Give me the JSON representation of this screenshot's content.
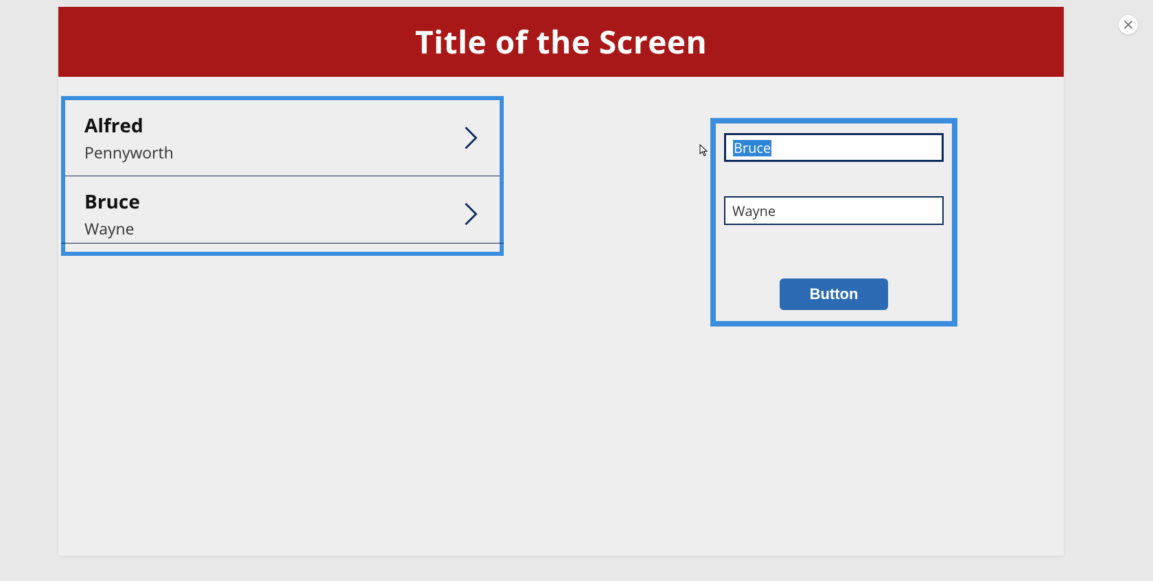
{
  "header": {
    "title": "Title of the Screen"
  },
  "list": {
    "items": [
      {
        "primary": "Alfred",
        "secondary": "Pennyworth"
      },
      {
        "primary": "Bruce",
        "secondary": "Wayne"
      }
    ]
  },
  "form": {
    "first_name_value": "Bruce",
    "last_name_value": "Wayne",
    "button_label": "Button"
  },
  "colors": {
    "header_bg": "#a81818",
    "highlight_border": "#3b8ede",
    "button_bg": "#2c6bb3",
    "input_border": "#0e2b5c",
    "selection_bg": "#2f86d6"
  }
}
